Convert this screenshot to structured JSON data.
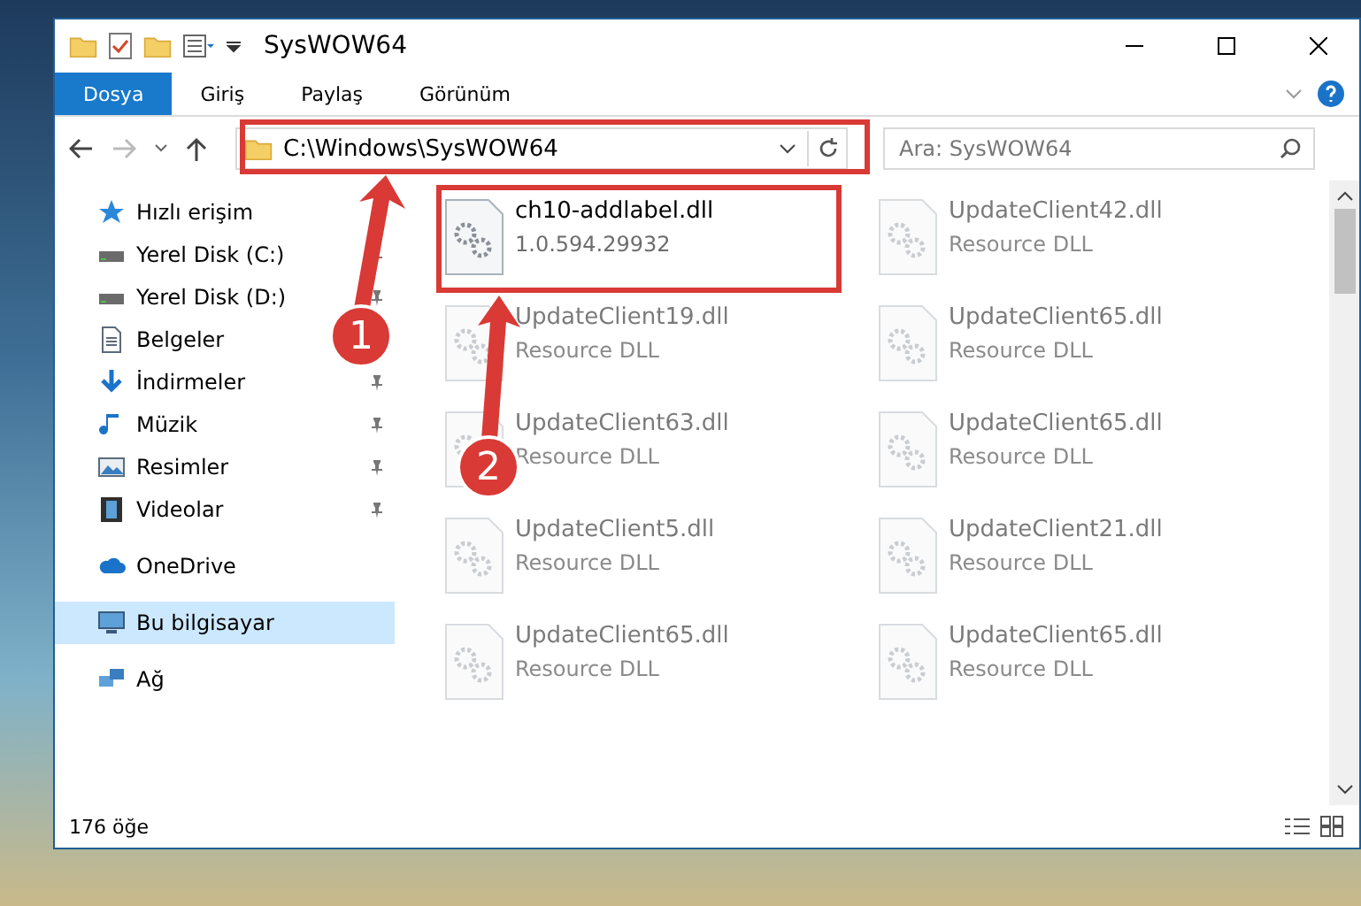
{
  "window": {
    "title": "SysWOW64"
  },
  "ribbon_tabs": [
    {
      "label": "Dosya",
      "selected": true
    },
    {
      "label": "Giriş",
      "selected": false
    },
    {
      "label": "Paylaş",
      "selected": false
    },
    {
      "label": "Görünüm",
      "selected": false
    }
  ],
  "address": {
    "path": "C:\\Windows\\SysWOW64"
  },
  "search": {
    "placeholder": "Ara: SysWOW64"
  },
  "sidebar": {
    "groups": [
      [
        {
          "kind": "star",
          "label": "Hızlı erişim",
          "pinned": false,
          "selected": false
        },
        {
          "kind": "drive",
          "label": "Yerel Disk (C:)",
          "pinned": true,
          "selected": false
        },
        {
          "kind": "drive",
          "label": "Yerel Disk (D:)",
          "pinned": true,
          "selected": false
        },
        {
          "kind": "document",
          "label": "Belgeler",
          "pinned": false,
          "selected": false
        },
        {
          "kind": "download",
          "label": "İndirmeler",
          "pinned": true,
          "selected": false
        },
        {
          "kind": "music",
          "label": "Müzik",
          "pinned": true,
          "selected": false
        },
        {
          "kind": "picture",
          "label": "Resimler",
          "pinned": true,
          "selected": false
        },
        {
          "kind": "film",
          "label": "Videolar",
          "pinned": true,
          "selected": false
        }
      ],
      [
        {
          "kind": "cloud",
          "label": "OneDrive",
          "pinned": false,
          "selected": false
        }
      ],
      [
        {
          "kind": "computer",
          "label": "Bu bilgisayar",
          "pinned": false,
          "selected": true
        }
      ],
      [
        {
          "kind": "network",
          "label": "Ağ",
          "pinned": false,
          "selected": false
        }
      ]
    ]
  },
  "files": [
    {
      "name": "ch10-addlabel.dll",
      "detail": "1.0.594.29932",
      "faded": false
    },
    {
      "name": "UpdateClient42.dll",
      "detail": "Resource DLL",
      "faded": true
    },
    {
      "name": "UpdateClient19.dll",
      "detail": "Resource DLL",
      "faded": true
    },
    {
      "name": "UpdateClient65.dll",
      "detail": "Resource DLL",
      "faded": true
    },
    {
      "name": "UpdateClient63.dll",
      "detail": "Resource DLL",
      "faded": true
    },
    {
      "name": "UpdateClient65.dll",
      "detail": "Resource DLL",
      "faded": true
    },
    {
      "name": "UpdateClient5.dll",
      "detail": "Resource DLL",
      "faded": true
    },
    {
      "name": "UpdateClient21.dll",
      "detail": "Resource DLL",
      "faded": true
    },
    {
      "name": "UpdateClient65.dll",
      "detail": "Resource DLL",
      "faded": true
    },
    {
      "name": "UpdateClient65.dll",
      "detail": "Resource DLL",
      "faded": true
    }
  ],
  "status_bar": {
    "count": "176 öğe"
  },
  "annotations": [
    {
      "number": "1"
    },
    {
      "number": "2"
    }
  ]
}
